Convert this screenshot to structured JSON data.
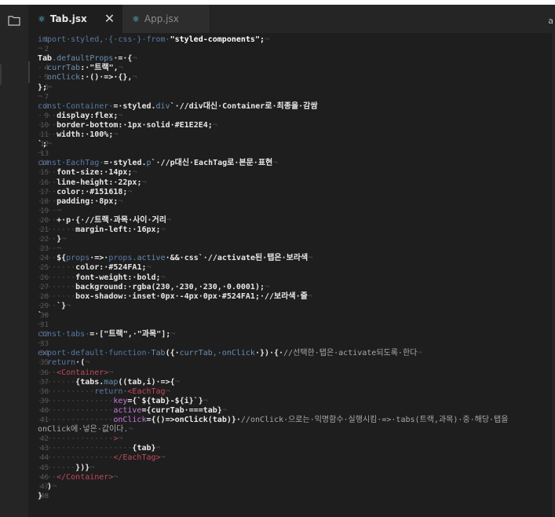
{
  "tabs": [
    {
      "name": "Tab.jsx",
      "close": "✕"
    },
    {
      "name": "App.jsx"
    }
  ],
  "tab_edge_label": "a",
  "icons": {
    "explorer": "files-icon",
    "react": "react-file-icon"
  },
  "lines": [
    {
      "n": "1",
      "segs": [
        [
          "k",
          "import·styled,·{·css·}·from·"
        ],
        [
          "s",
          "\"styled-components\";"
        ],
        [
          "d",
          "¬"
        ]
      ]
    },
    {
      "n": "2",
      "segs": [
        [
          "d",
          "¬"
        ]
      ]
    },
    {
      "n": "3",
      "segs": [
        [
          "w",
          "Tab"
        ],
        [
          "f",
          ".defaultProps"
        ],
        [
          "w",
          "·=·{"
        ],
        [
          "d",
          "¬"
        ]
      ]
    },
    {
      "n": "4",
      "segs": [
        [
          "d",
          "··"
        ],
        [
          "f",
          "currTab"
        ],
        [
          "w",
          ":·\"트랙\","
        ],
        [
          "d",
          "¬"
        ]
      ]
    },
    {
      "n": "5",
      "segs": [
        [
          "d",
          "··"
        ],
        [
          "f",
          "onClick"
        ],
        [
          "w",
          ":·()·=>·{},"
        ],
        [
          "d",
          "¬"
        ]
      ]
    },
    {
      "n": "6",
      "segs": [
        [
          "w",
          "};"
        ],
        [
          "d",
          "¬"
        ]
      ]
    },
    {
      "n": "7",
      "segs": [
        [
          "d",
          "¬"
        ]
      ]
    },
    {
      "n": "8",
      "segs": [
        [
          "k",
          "const·Container·"
        ],
        [
          "w",
          "=·styled."
        ],
        [
          "f",
          "div"
        ],
        [
          "w",
          "`·//div대신·Container로·최종을·감쌈"
        ]
      ]
    },
    {
      "n": "9",
      "segs": [
        [
          "d",
          "····"
        ],
        [
          "w",
          "display:flex;"
        ],
        [
          "d",
          "¬"
        ]
      ]
    },
    {
      "n": "10",
      "segs": [
        [
          "d",
          "····"
        ],
        [
          "w",
          "border-bottom:·1px·solid·#E1E2E4;"
        ],
        [
          "d",
          "¬"
        ]
      ]
    },
    {
      "n": "11",
      "segs": [
        [
          "d",
          "····"
        ],
        [
          "w",
          "width:·100%;"
        ],
        [
          "d",
          "¬"
        ]
      ]
    },
    {
      "n": "12",
      "segs": [
        [
          "w",
          "`;"
        ],
        [
          "d",
          "¬"
        ]
      ]
    },
    {
      "n": "13",
      "segs": [
        [
          "d",
          "¬"
        ]
      ]
    },
    {
      "n": "14",
      "segs": [
        [
          "k",
          "const·EachTag·"
        ],
        [
          "w",
          "=·styled."
        ],
        [
          "f",
          "p"
        ],
        [
          "w",
          "`·//p대신·EachTag로·본문·표현"
        ],
        [
          "d",
          "¬"
        ]
      ]
    },
    {
      "n": "15",
      "segs": [
        [
          "d",
          "····"
        ],
        [
          "w",
          "font-size:·14px;"
        ],
        [
          "d",
          "¬"
        ]
      ]
    },
    {
      "n": "16",
      "segs": [
        [
          "d",
          "····"
        ],
        [
          "w",
          "line-height:·22px;"
        ],
        [
          "d",
          "¬"
        ]
      ]
    },
    {
      "n": "17",
      "segs": [
        [
          "d",
          "····"
        ],
        [
          "w",
          "color:·#151618;"
        ],
        [
          "d",
          "¬"
        ]
      ]
    },
    {
      "n": "18",
      "segs": [
        [
          "d",
          "····"
        ],
        [
          "w",
          "padding:·8px;"
        ],
        [
          "d",
          "¬"
        ]
      ]
    },
    {
      "n": "19",
      "segs": [
        [
          "d",
          "····¬"
        ]
      ]
    },
    {
      "n": "20",
      "segs": [
        [
          "d",
          "····"
        ],
        [
          "w",
          "+·p·{·//트랙·과목·사이·거리"
        ],
        [
          "d",
          "¬"
        ]
      ]
    },
    {
      "n": "21",
      "segs": [
        [
          "d",
          "········"
        ],
        [
          "w",
          "margin-left:·16px;"
        ],
        [
          "d",
          "¬"
        ]
      ]
    },
    {
      "n": "22",
      "segs": [
        [
          "d",
          "····"
        ],
        [
          "w",
          "}"
        ],
        [
          "d",
          "¬"
        ]
      ]
    },
    {
      "n": "23",
      "segs": [
        [
          "d",
          "····¬"
        ]
      ]
    },
    {
      "n": "24",
      "segs": [
        [
          "d",
          "····"
        ],
        [
          "w",
          "${"
        ],
        [
          "k",
          "props"
        ],
        [
          "w",
          "·=>·"
        ],
        [
          "k",
          "props"
        ],
        [
          "f",
          ".active"
        ],
        [
          "w",
          "·&&·css`·//activate된·탭은·보라색"
        ],
        [
          "d",
          "¬"
        ]
      ]
    },
    {
      "n": "25",
      "segs": [
        [
          "d",
          "········"
        ],
        [
          "w",
          "color:·#524FA1;"
        ],
        [
          "d",
          "¬"
        ]
      ]
    },
    {
      "n": "26",
      "segs": [
        [
          "d",
          "········"
        ],
        [
          "w",
          "font-weight:·bold;"
        ],
        [
          "d",
          "¬"
        ]
      ]
    },
    {
      "n": "27",
      "segs": [
        [
          "d",
          "········"
        ],
        [
          "w",
          "background:·rgba(230,·230,·230,·0.0001);"
        ],
        [
          "d",
          "¬"
        ]
      ]
    },
    {
      "n": "28",
      "segs": [
        [
          "d",
          "········"
        ],
        [
          "w",
          "box-shadow:·inset·0px·-4px·0px·#524FA1;·//보라색·줄"
        ],
        [
          "d",
          "¬"
        ]
      ]
    },
    {
      "n": "29",
      "segs": [
        [
          "d",
          "····"
        ],
        [
          "w",
          "`}"
        ],
        [
          "d",
          "¬"
        ]
      ]
    },
    {
      "n": "30",
      "segs": [
        [
          "w",
          "`"
        ],
        [
          "d",
          "¬"
        ]
      ]
    },
    {
      "n": "31",
      "segs": [
        [
          "d",
          "¬"
        ]
      ]
    },
    {
      "n": "32",
      "segs": [
        [
          "k",
          "const·tabs·"
        ],
        [
          "w",
          "=·[\"트랙\",·\"과목\"];"
        ],
        [
          "d",
          "¬"
        ]
      ]
    },
    {
      "n": "33",
      "segs": [
        [
          "d",
          "¬"
        ]
      ]
    },
    {
      "n": "34",
      "segs": [
        [
          "k",
          "export·default·function·"
        ],
        [
          "f",
          "Tab"
        ],
        [
          "w",
          "({·"
        ],
        [
          "f",
          "currTab,·onClick"
        ],
        [
          "w",
          "·})·{·"
        ],
        [
          "c",
          "//선택한·탭은·activate되도록·한다"
        ],
        [
          "d",
          "¬"
        ]
      ]
    },
    {
      "n": "35",
      "segs": [
        [
          "d",
          "··"
        ],
        [
          "k",
          "return"
        ],
        [
          "w",
          "·("
        ],
        [
          "d",
          "¬"
        ]
      ]
    },
    {
      "n": "36",
      "segs": [
        [
          "d",
          "····"
        ],
        [
          "t",
          "<Container>"
        ],
        [
          "d",
          "¬"
        ]
      ]
    },
    {
      "n": "37",
      "segs": [
        [
          "d",
          "········"
        ],
        [
          "w",
          "{tabs."
        ],
        [
          "f",
          "map"
        ],
        [
          "w",
          "((tab,i)·=>{"
        ],
        [
          "d",
          "¬"
        ]
      ]
    },
    {
      "n": "38",
      "segs": [
        [
          "d",
          "············"
        ],
        [
          "k",
          "return·"
        ],
        [
          "t",
          "<EachTag"
        ],
        [
          "d",
          "¬"
        ]
      ]
    },
    {
      "n": "39",
      "segs": [
        [
          "d",
          "················"
        ],
        [
          "a",
          "key"
        ],
        [
          "w",
          "={`${tab}-${i}`}"
        ],
        [
          "d",
          "¬"
        ]
      ]
    },
    {
      "n": "40",
      "segs": [
        [
          "d",
          "················"
        ],
        [
          "a",
          "active"
        ],
        [
          "w",
          "={currTab·===tab}"
        ],
        [
          "d",
          "¬"
        ]
      ]
    },
    {
      "n": "41",
      "segs": [
        [
          "d",
          "················"
        ],
        [
          "a",
          "onClick"
        ],
        [
          "w",
          "={()=>onClick(tab)}·"
        ],
        [
          "c",
          "//onClick·으로는·익명함수·실행시킴·=>·tabs(트랙,과목)·중·해당·탭을"
        ]
      ]
    },
    {
      "n": "",
      "segs": [
        [
          "c",
          "onClick에·넣은·값이다."
        ],
        [
          "d",
          "¬"
        ]
      ]
    },
    {
      "n": "42",
      "segs": [
        [
          "d",
          "················"
        ],
        [
          "t",
          ">"
        ],
        [
          "d",
          "¬"
        ]
      ]
    },
    {
      "n": "43",
      "segs": [
        [
          "d",
          "····················"
        ],
        [
          "w",
          "{tab}"
        ],
        [
          "d",
          "¬"
        ]
      ]
    },
    {
      "n": "44",
      "segs": [
        [
          "d",
          "················"
        ],
        [
          "t",
          "</EachTag>"
        ],
        [
          "d",
          "¬"
        ]
      ]
    },
    {
      "n": "45",
      "segs": [
        [
          "d",
          "········"
        ],
        [
          "w",
          "})}"
        ],
        [
          "d",
          "¬"
        ]
      ]
    },
    {
      "n": "46",
      "segs": [
        [
          "d",
          "····"
        ],
        [
          "t",
          "</Container>"
        ],
        [
          "d",
          "¬"
        ]
      ]
    },
    {
      "n": "47",
      "segs": [
        [
          "d",
          "··"
        ],
        [
          "w",
          ")"
        ],
        [
          "d",
          "¬"
        ]
      ]
    },
    {
      "n": "48",
      "segs": [
        [
          "w",
          "}"
        ],
        [
          "d",
          "¬"
        ]
      ]
    }
  ]
}
